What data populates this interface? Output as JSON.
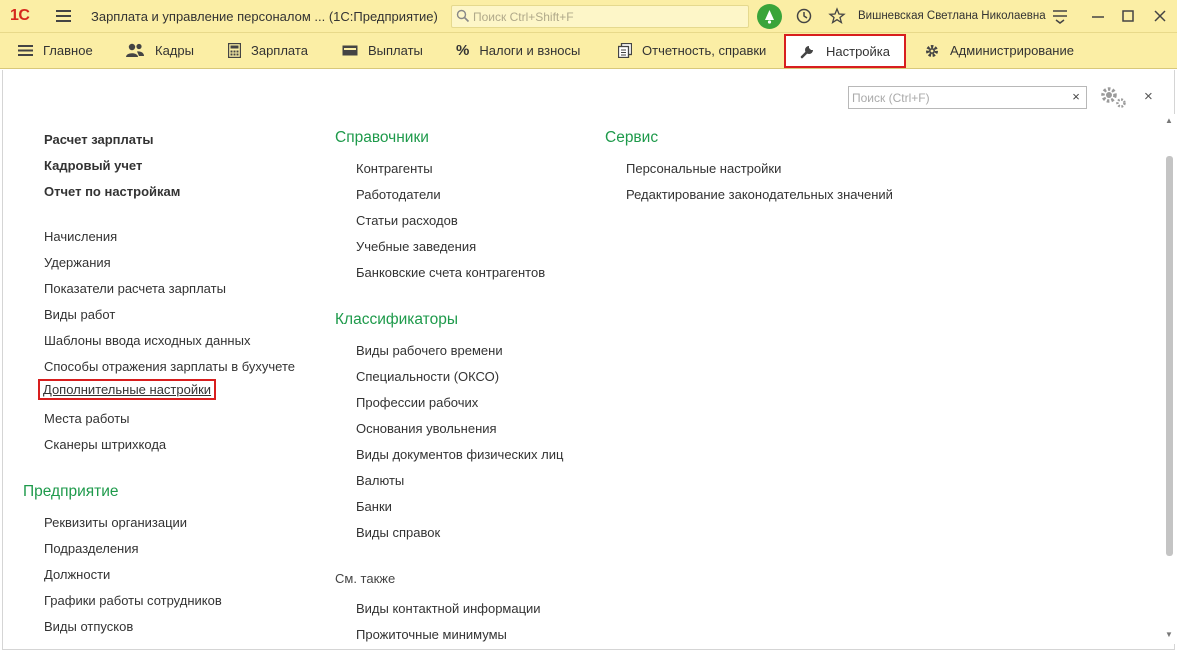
{
  "titlebar": {
    "logo": "1С",
    "title": "Зарплата и управление персоналом ... (1С:Предприятие)",
    "search_placeholder": "Поиск Ctrl+Shift+F",
    "user": "Вишневская Светлана Николаевна"
  },
  "sections": [
    {
      "label": "Главное",
      "icon": "menu-icon"
    },
    {
      "label": "Кадры",
      "icon": "people-icon"
    },
    {
      "label": "Зарплата",
      "icon": "calculator-icon"
    },
    {
      "label": "Выплаты",
      "icon": "wallet-icon"
    },
    {
      "label": "Налоги и взносы",
      "icon": "percent-icon"
    },
    {
      "label": "Отчетность, справки",
      "icon": "documents-icon"
    },
    {
      "label": "Настройка",
      "icon": "wrench-icon",
      "active": true
    },
    {
      "label": "Администрирование",
      "icon": "gear-icon"
    }
  ],
  "panel": {
    "search_placeholder": "Поиск (Ctrl+F)",
    "clear": "×",
    "close": "×"
  },
  "col1": {
    "bold_links": [
      "Расчет зарплаты",
      "Кадровый учет",
      "Отчет по настройкам"
    ],
    "links": [
      "Начисления",
      "Удержания",
      "Показатели расчета зарплаты",
      "Виды работ",
      "Шаблоны ввода исходных данных",
      "Способы отражения зарплаты в бухучете",
      "Дополнительные настройки",
      "Места работы",
      "Сканеры штрихкода"
    ],
    "enterprise_heading": "Предприятие",
    "enterprise_links": [
      "Реквизиты организации",
      "Подразделения",
      "Должности",
      "Графики работы сотрудников",
      "Виды отпусков"
    ]
  },
  "col2": {
    "ref_heading": "Справочники",
    "ref_links": [
      "Контрагенты",
      "Работодатели",
      "Статьи расходов",
      "Учебные заведения",
      "Банковские счета контрагентов"
    ],
    "cls_heading": "Классификаторы",
    "cls_links": [
      "Виды рабочего времени",
      "Специальности (ОКСО)",
      "Профессии рабочих",
      "Основания увольнения",
      "Виды документов физических лиц",
      "Валюты",
      "Банки",
      "Виды справок"
    ],
    "see_also": "См. также",
    "see_links": [
      "Виды контактной информации",
      "Прожиточные минимумы"
    ]
  },
  "col3": {
    "service_heading": "Сервис",
    "service_links": [
      "Персональные настройки",
      "Редактирование законодательных значений"
    ]
  },
  "colors": {
    "accent": "#fbeea5",
    "heading": "#1e9a4b",
    "highlight": "#d81e1e",
    "bell": "#3aa43a"
  }
}
